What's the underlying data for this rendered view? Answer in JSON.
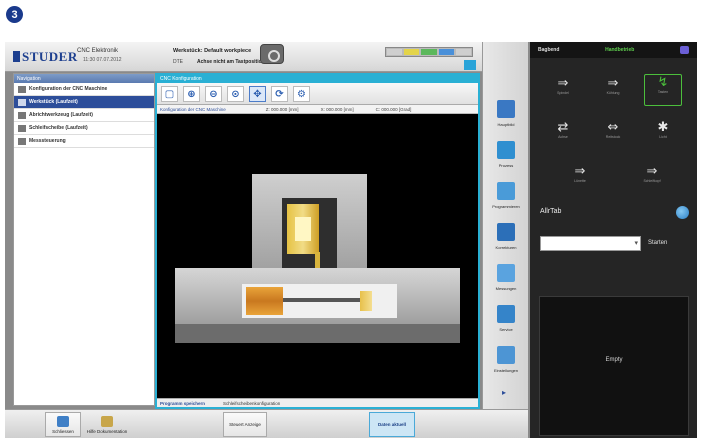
{
  "step": {
    "number": "3"
  },
  "header": {
    "brand": "STUDER",
    "app_title": "CNC Elektronik",
    "app_subtitle": "11:30 07.07.2012",
    "workpiece_label": "Werkstück: Default workpiece",
    "mode": "DTE",
    "status": "Achse nicht am Tastposition 0"
  },
  "sidebar": {
    "header": "Navigation",
    "items": [
      {
        "label": "Konfiguration der CNC Maschine",
        "icon": "machine-icon",
        "active": false
      },
      {
        "label": "Werkstück (Laufzeit)",
        "icon": "workpiece-icon",
        "active": true
      },
      {
        "label": "Abrichtwerkzeug (Laufzeit)",
        "icon": "dresser-icon",
        "active": false
      },
      {
        "label": "Schleifscheibe (Laufzeit)",
        "icon": "wheel-icon",
        "active": false
      },
      {
        "label": "Messsteuerung",
        "icon": "gauge-icon",
        "active": false
      }
    ]
  },
  "graphic_window": {
    "title": "CNC Konfiguration",
    "toolbar": [
      {
        "name": "frame-icon",
        "glyph": "▢",
        "active": false
      },
      {
        "name": "zoom-in-icon",
        "glyph": "⊕",
        "active": false
      },
      {
        "name": "zoom-out-icon",
        "glyph": "⊖",
        "active": false
      },
      {
        "name": "zoom-fit-icon",
        "glyph": "⊙",
        "active": false
      },
      {
        "name": "pan-icon",
        "glyph": "✥",
        "active": true
      },
      {
        "name": "rotate-icon",
        "glyph": "⟳",
        "active": false
      },
      {
        "name": "settings-icon",
        "glyph": "⚙",
        "active": false
      }
    ],
    "info_label": "Konfiguration der CNC Maschine",
    "coords": [
      "Z: 000.000 [mm]",
      "X: 000.000 [mm]",
      "C: 000.000 [Grad]"
    ],
    "footer_link": "Programm speichern",
    "footer_text": "Schleifscheibenkonfiguration"
  },
  "right_toolbar": [
    {
      "label": "Hauptbild",
      "icon": "main-image-icon",
      "color": "#3a78c3"
    },
    {
      "label": "Prozess",
      "icon": "process-icon",
      "color": "#2f8fd0"
    },
    {
      "label": "Programmieren",
      "icon": "programming-icon",
      "color": "#4a9bd8"
    },
    {
      "label": "Korrekturen",
      "icon": "corrections-icon",
      "color": "#2c6fb8"
    },
    {
      "label": "Messungen",
      "icon": "measurements-icon",
      "color": "#5aa3df"
    },
    {
      "label": "Service",
      "icon": "service-icon",
      "color": "#3584c9"
    },
    {
      "label": "Einstellungen",
      "icon": "settings-list-icon",
      "color": "#4d95d4"
    }
  ],
  "dark_panel": {
    "tabs": [
      "Bagbend",
      "Handbetrieb"
    ],
    "active_tab": "Handbetrieb",
    "buttons": [
      {
        "glyph": "⇒",
        "caption": "Spindel"
      },
      {
        "glyph": "⇒",
        "caption": "Kühlung"
      },
      {
        "glyph": "↯",
        "caption": "Tasten"
      },
      {
        "glyph": "⇄",
        "caption": "Achse"
      },
      {
        "glyph": "⇔",
        "caption": "Reitstock"
      },
      {
        "glyph": "✱",
        "caption": "Licht"
      },
      {
        "glyph": "⇒",
        "caption": "Lünette"
      },
      {
        "glyph": "⇒",
        "caption": "Schleifkopf"
      }
    ],
    "alltab_label": "AllrTab",
    "start_label": "Starten",
    "empty_label": "Empty"
  },
  "bottom_bar": [
    {
      "label": "Schliessen",
      "icon": "close-window-icon",
      "color": "#3f7fc6"
    },
    {
      "label": "Hilfe Dokumentation",
      "icon": "help-folder-icon",
      "color": "#c8a64a"
    },
    {
      "label": "Steuert Anzeige",
      "icon": "",
      "color": ""
    },
    {
      "label": "Daten aktuell",
      "icon": "",
      "color": ""
    }
  ]
}
